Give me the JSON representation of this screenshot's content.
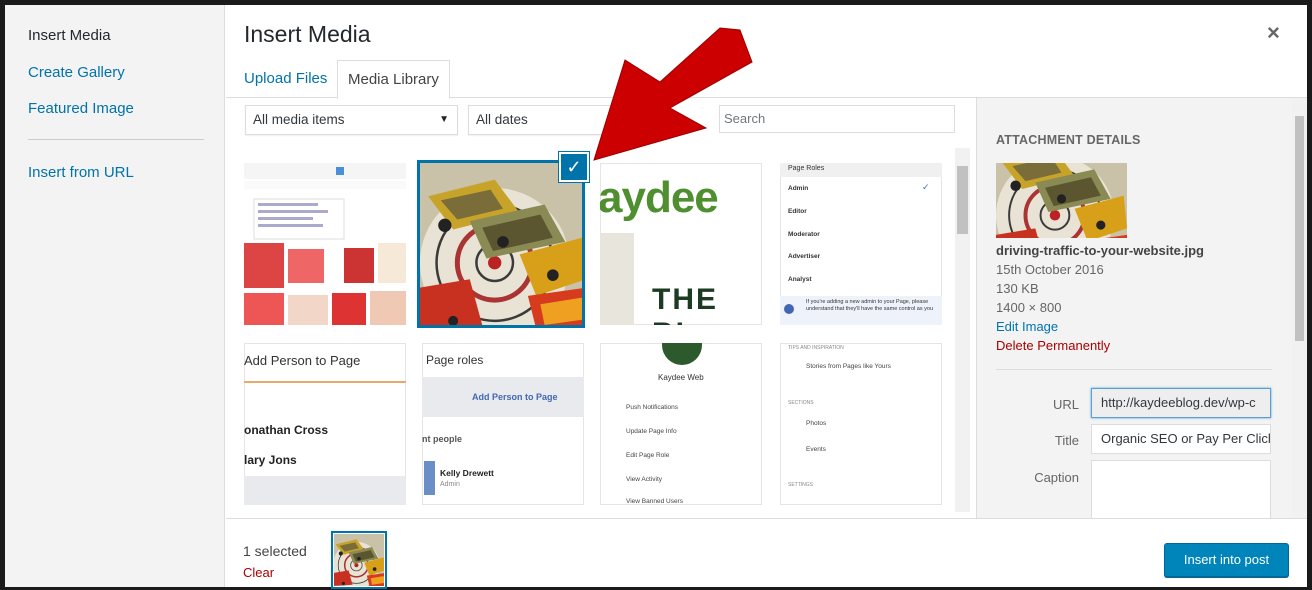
{
  "menu": {
    "items": [
      {
        "label": "Insert Media",
        "active": true
      },
      {
        "label": "Create Gallery",
        "active": false
      },
      {
        "label": "Featured Image",
        "active": false
      },
      {
        "label": "Insert from URL",
        "active": false
      }
    ]
  },
  "dialog": {
    "title": "Insert Media",
    "close_icon": "×",
    "tabs": [
      {
        "label": "Upload Files",
        "active": false
      },
      {
        "label": "Media Library",
        "active": true
      }
    ]
  },
  "filters": {
    "media_type": "All media items",
    "dates": "All dates",
    "search_placeholder": "Search"
  },
  "grid": {
    "thumbs": [
      {
        "text": ""
      },
      {
        "text": ""
      },
      {
        "text": "aydee THE BL"
      },
      {
        "text": "Page Roles"
      },
      {
        "text": "Add Person to Page"
      },
      {
        "text": "Page roles"
      },
      {
        "text": "Kaydee Web"
      },
      {
        "text": "Stories from Pages like Yours"
      }
    ]
  },
  "thumb_texts": {
    "page_roles": {
      "title": "Page Roles",
      "items": [
        "Admin",
        "Editor",
        "Moderator",
        "Advertiser",
        "Analyst"
      ],
      "note": "If you're adding a new admin to your Page, please understand that they'll have the same control as you"
    },
    "add_person": {
      "title": "Add Person to Page",
      "names": [
        "onathan Cross",
        "lary Jons"
      ]
    },
    "page_roles2": {
      "title": "Page roles",
      "button": "Add Person to Page",
      "section": "nt people",
      "person": "Kelly Drewett",
      "person_role": "Admin"
    },
    "kaydee": {
      "name": "Kaydee Web",
      "items": [
        "Push Notifications",
        "Update Page Info",
        "Edit Page Role",
        "View Activity",
        "View Banned Users"
      ]
    },
    "stories": {
      "head": "TIPS AND INSPIRATION",
      "item": "Stories from Pages like Yours",
      "sections": "SECTIONS",
      "photos": "Photos",
      "events": "Events",
      "settings": "SETTINGS"
    },
    "blog_logo": {
      "line1": "aydee",
      "line2": "THE BL"
    }
  },
  "details": {
    "heading": "Attachment Details",
    "filename": "driving-traffic-to-your-website.jpg",
    "date": "15th October 2016",
    "size": "130 KB",
    "dimensions": "1400 × 800",
    "edit": "Edit Image",
    "delete": "Delete Permanently",
    "fields": {
      "url_label": "URL",
      "url_value": "http://kaydeeblog.dev/wp-c",
      "title_label": "Title",
      "title_value": "Organic SEO or Pay Per Clicl",
      "caption_label": "Caption"
    }
  },
  "footer": {
    "selected": "1 selected",
    "clear": "Clear",
    "insert_button": "Insert into post"
  },
  "colors": {
    "accent": "#0073aa",
    "button": "#0085ba",
    "danger": "#a00",
    "arrow": "#c00"
  }
}
